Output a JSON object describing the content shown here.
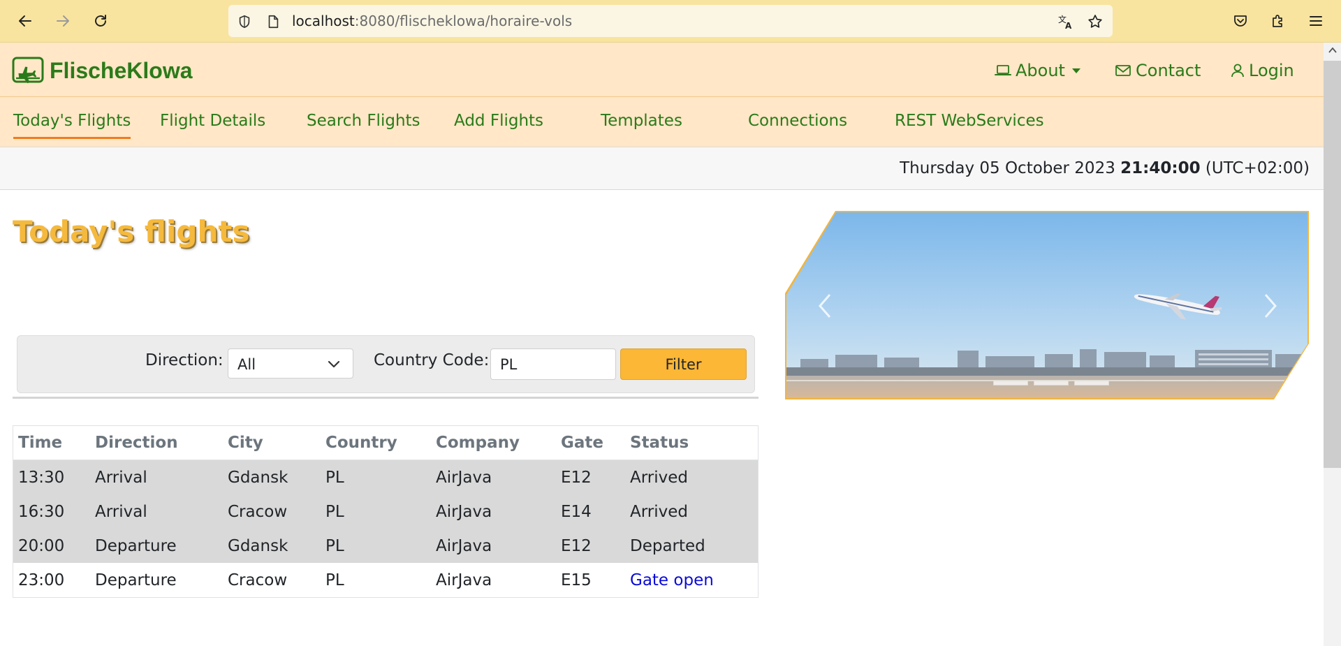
{
  "browser": {
    "url_host": "localhost",
    "url_path": ":8080/flischeklowa/horaire-vols"
  },
  "brand": {
    "name": "FlischeKlowa"
  },
  "nav": {
    "about": "About",
    "contact": "Contact",
    "login": "Login"
  },
  "tabs": [
    {
      "label": "Today's Flights",
      "active": true
    },
    {
      "label": "Flight Details"
    },
    {
      "label": "Search Flights"
    },
    {
      "label": "Add Flights"
    },
    {
      "label": "Templates"
    },
    {
      "label": "Connections"
    },
    {
      "label": "REST WebServices"
    }
  ],
  "datetime": {
    "date": "Thursday 05 October 2023",
    "time": "21:40:00",
    "timezone": "(UTC+02:00)"
  },
  "page": {
    "title": "Today's flights"
  },
  "filter": {
    "direction_label": "Direction:",
    "direction_value": "All",
    "country_label": "Country Code:",
    "country_value": "PL",
    "button_label": "Filter"
  },
  "table": {
    "headers": [
      "Time",
      "Direction",
      "City",
      "Country",
      "Company",
      "Gate",
      "Status"
    ],
    "rows": [
      [
        "13:30",
        "Arrival",
        "Gdansk",
        "PL",
        "AirJava",
        "E12",
        "Arrived"
      ],
      [
        "16:30",
        "Arrival",
        "Cracow",
        "PL",
        "AirJava",
        "E14",
        "Arrived"
      ],
      [
        "20:00",
        "Departure",
        "Gdansk",
        "PL",
        "AirJava",
        "E12",
        "Departed"
      ],
      [
        "23:00",
        "Departure",
        "Cracow",
        "PL",
        "AirJava",
        "E15",
        "Gate open"
      ]
    ]
  },
  "colors": {
    "brand_green": "#2b7a1a",
    "nav_bg": "#ffe7c7",
    "accent_orange": "#fbb735",
    "link_blue": "#0a0ad8"
  },
  "icons": {
    "back": "arrow-left-icon",
    "forward": "arrow-right-icon",
    "reload": "reload-icon",
    "shield": "shield-icon",
    "page": "page-icon",
    "translate": "translate-icon",
    "star": "star-icon",
    "pocket": "pocket-icon",
    "extensions": "puzzle-icon",
    "menu": "hamburger-icon",
    "logo": "airplane-logo-icon",
    "about": "laptop-icon",
    "contact": "envelope-icon",
    "login": "person-icon"
  }
}
